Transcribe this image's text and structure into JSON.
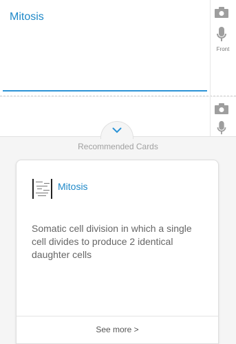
{
  "front": {
    "text": "Mitosis",
    "side_label": "Front",
    "camera_icon": "camera-icon",
    "mic_icon": "microphone-icon"
  },
  "back": {
    "camera_icon": "camera-icon",
    "mic_icon": "microphone-icon"
  },
  "recommended": {
    "title": "Recommended Cards",
    "toggle_icon": "chevron-down-icon",
    "card": {
      "title": "Mitosis",
      "body": "Somatic cell division in which a single cell divides to produce 2 identical daughter cells",
      "see_more": "See more >"
    }
  },
  "colors": {
    "accent": "#1e88c8",
    "underline": "#2b93d6",
    "icon_gray": "#9e9e9e"
  }
}
